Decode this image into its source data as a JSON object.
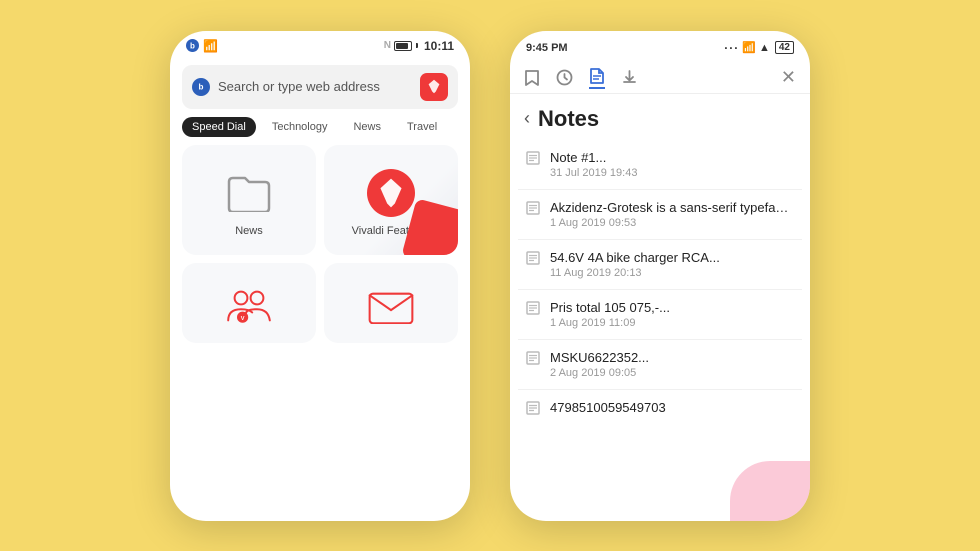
{
  "background_color": "#F5D96B",
  "phone_left": {
    "status": {
      "left_icon": "b-icon",
      "wifi": "wifi",
      "time": "10:11",
      "nfc": "nfc",
      "battery": "battery"
    },
    "search_bar": {
      "placeholder": "Search or type web address",
      "button_icon": "vivaldi-v"
    },
    "tabs": [
      {
        "label": "Speed Dial",
        "active": true
      },
      {
        "label": "Technology",
        "active": false
      },
      {
        "label": "News",
        "active": false
      },
      {
        "label": "Travel",
        "active": false
      }
    ],
    "dial_items": [
      {
        "label": "News",
        "icon": "folder"
      },
      {
        "label": "Vivaldi Features",
        "icon": "vivaldi"
      }
    ],
    "dial_items_bottom": [
      {
        "label": "Community",
        "icon": "people"
      },
      {
        "label": "Mail",
        "icon": "mail"
      }
    ]
  },
  "phone_right": {
    "status": {
      "time": "9:45 PM",
      "dots": "···",
      "signal": "signal",
      "wifi": "wifi",
      "battery": "42"
    },
    "toolbar_icons": [
      "bookmark",
      "clock",
      "document",
      "download"
    ],
    "active_icon_index": 2,
    "title": "Notes",
    "notes": [
      {
        "title": "Note #1...",
        "date": "31 Jul 2019 19:43"
      },
      {
        "title": "Akzidenz-Grotesk is a sans-serif typeface ...",
        "date": "1 Aug 2019 09:53"
      },
      {
        "title": "54.6V 4A bike charger RCA...",
        "date": "11 Aug 2019 20:13"
      },
      {
        "title": "Pris total 105 075,-...",
        "date": "1 Aug 2019 11:09"
      },
      {
        "title": "MSKU6622352...",
        "date": "2 Aug 2019 09:05"
      },
      {
        "title": "4798510059549703",
        "date": ""
      }
    ]
  }
}
